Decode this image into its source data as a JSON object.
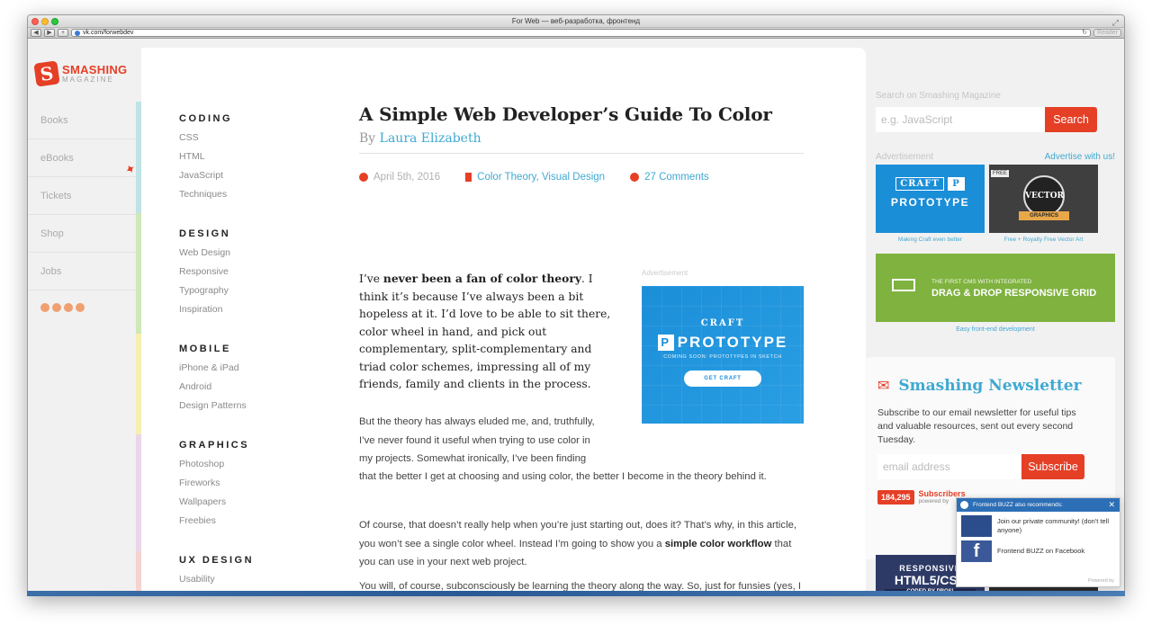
{
  "window": {
    "title": "For Web — веб-разработка, фронтенд",
    "url": "vk.com/forwebdev",
    "reader_label": "Reader"
  },
  "logo": {
    "name": "SMASHING",
    "sub": "MAGAZINE",
    "mark": "S"
  },
  "leftnav": {
    "items": [
      "Books",
      "eBooks",
      "Tickets",
      "Shop",
      "Jobs"
    ]
  },
  "categories": [
    {
      "title": "CODING",
      "links": [
        "CSS",
        "HTML",
        "JavaScript",
        "Techniques"
      ]
    },
    {
      "title": "DESIGN",
      "links": [
        "Web Design",
        "Responsive",
        "Typography",
        "Inspiration"
      ]
    },
    {
      "title": "MOBILE",
      "links": [
        "iPhone & iPad",
        "Android",
        "Design Patterns"
      ]
    },
    {
      "title": "GRAPHICS",
      "links": [
        "Photoshop",
        "Fireworks",
        "Wallpapers",
        "Freebies"
      ]
    },
    {
      "title": "UX DESIGN",
      "links": [
        "Usability"
      ]
    }
  ],
  "article": {
    "title": "A Simple Web Developer’s Guide To Color",
    "by": "By",
    "author": "Laura Elizabeth",
    "date": "April 5th, 2016",
    "tags": "Color Theory, Visual Design",
    "comments": "27 Comments",
    "intro_pre": "I’ve ",
    "intro_bold": "never been a fan of color theory",
    "intro_post": ". I think it’s because I’ve always been a bit hopeless at it. I’d love to be able to sit there, color wheel in hand, and pick out complementary, split-complementary and triad color schemes, impressing all of my friends, family and clients in the process.",
    "p1_a": "But the theory has always eluded me, and, truthfully,",
    "p1_b": "I’ve never found it useful when trying to use color in",
    "p1_c": "my projects. Somewhat ironically, I’ve been finding",
    "p1_d": "that the better I get at choosing and using color, the better I become in the theory behind it.",
    "p2_pre": "Of course, that doesn’t really help when you’re just starting out, does it? That’s why, in this article, you won’t see a single color wheel. Instead I’m going to show you a ",
    "p2_bold": "simple color workflow",
    "p2_post": " that you can use in your next web project.",
    "p3": "You will, of course, subconsciously be learning the theory along the way. So, just for funsies (yes, I said “funsies”), I recommend coming back in a few months time and giving the theory another go."
  },
  "inline_ad": {
    "label": "Advertisement",
    "line1": "CRAFT",
    "line2": "PROTOTYPE",
    "line3": "COMING SOON: PROTOTYPES IN SKETCH",
    "button": "GET CRAFT"
  },
  "sidebar": {
    "search_label": "Search on Smashing Magazine",
    "search_placeholder": "e.g. JavaScript",
    "search_button": "Search",
    "ad_label": "Advertisement",
    "advertise_link": "Advertise with us!",
    "craft_ad": {
      "l1": "CRAFT",
      "l2": "PROTOTYPE",
      "caption": "Making Craft even better"
    },
    "vector_ad": {
      "free": "FREE",
      "center": "VECTOR",
      "ribbon": "GRAPHICS",
      "caption": "Free + Royalty Free Vector Art"
    },
    "grid_ad": {
      "l1": "THE FIRST CMS WITH INTEGRATED",
      "l2": "DRAG & DROP RESPONSIVE GRID",
      "caption": "Easy front-end development"
    },
    "newsletter": {
      "title": "Smashing Newsletter",
      "text": "Subscribe to our email newsletter for useful tips and valuable resources, sent out every second Tuesday.",
      "email_placeholder": "email address",
      "button": "Subscribe",
      "count": "184,295",
      "count_label": "Subscribers",
      "powered": "powered by"
    },
    "html5_ad": {
      "a": "RESPONSIVE",
      "b": "HTML5/CSS",
      "c": "CODED BY PROS!"
    }
  },
  "buzz": {
    "header": "Frontend BUZZ also recommends:",
    "item1": "Join our private community! (don't tell anyone)",
    "item2": "Frontend BUZZ on Facebook",
    "footer": "Powered by"
  },
  "colors": {
    "accent_red": "#e53f26",
    "link_blue": "#3fa9d1"
  }
}
